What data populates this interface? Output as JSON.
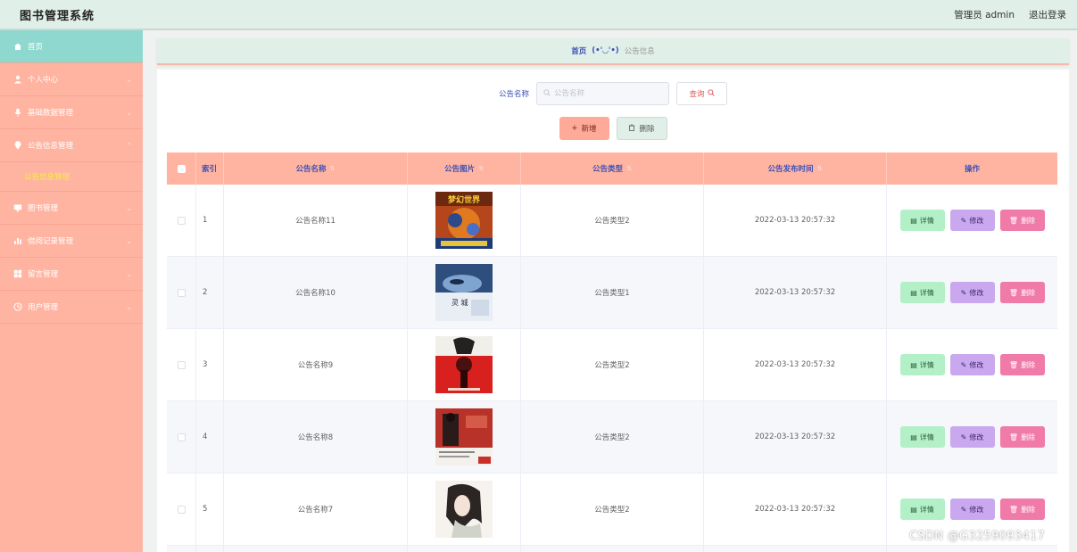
{
  "app": {
    "title": "图书管理系统"
  },
  "topbar": {
    "user_label": "管理员 admin",
    "logout_label": "退出登录"
  },
  "sidebar": {
    "items": [
      {
        "label": "首页",
        "icon": "home-icon"
      },
      {
        "label": "个人中心",
        "icon": "user-icon"
      },
      {
        "label": "基础数据管理",
        "icon": "mic-icon"
      },
      {
        "label": "公告信息管理",
        "icon": "pin-icon"
      },
      {
        "label": "图书管理",
        "icon": "monitor-icon"
      },
      {
        "label": "借阅记录管理",
        "icon": "bar-chart-icon"
      },
      {
        "label": "留言管理",
        "icon": "grid-icon"
      },
      {
        "label": "用户管理",
        "icon": "clock-icon"
      }
    ],
    "subitem": "公告信息管理"
  },
  "breadcrumb": {
    "home": "首页",
    "face": "(•'◡'•)",
    "current": "公告信息"
  },
  "search": {
    "label": "公告名称",
    "placeholder": "公告名称",
    "button": "查询"
  },
  "actions": {
    "add": "新增",
    "delete": "删除"
  },
  "table": {
    "headers": [
      "索引",
      "公告名称",
      "公告图片",
      "公告类型",
      "公告发布时间",
      "操作"
    ],
    "rows": [
      {
        "index": "1",
        "name": "公告名称11",
        "type": "公告类型2",
        "time": "2022-03-13 20:57:32"
      },
      {
        "index": "2",
        "name": "公告名称10",
        "type": "公告类型1",
        "time": "2022-03-13 20:57:32"
      },
      {
        "index": "3",
        "name": "公告名称9",
        "type": "公告类型2",
        "time": "2022-03-13 20:57:32"
      },
      {
        "index": "4",
        "name": "公告名称8",
        "type": "公告类型2",
        "time": "2022-03-13 20:57:32"
      },
      {
        "index": "5",
        "name": "公告名称7",
        "type": "公告类型2",
        "time": "2022-03-13 20:57:32"
      }
    ],
    "op_detail": "详情",
    "op_edit": "修改",
    "op_delete": "删除"
  },
  "cover_text": {
    "c1": "梦幻世界",
    "c2": "灵 城"
  },
  "watermark": "CSDN @G3259093417",
  "colors": {
    "header_bg": "#e1efe9",
    "sidebar_bg": "#ffb4a2",
    "sidebar_active": "#8fd8cf",
    "table_head": "#ffb4a2",
    "link_blue": "#3f51b5"
  }
}
